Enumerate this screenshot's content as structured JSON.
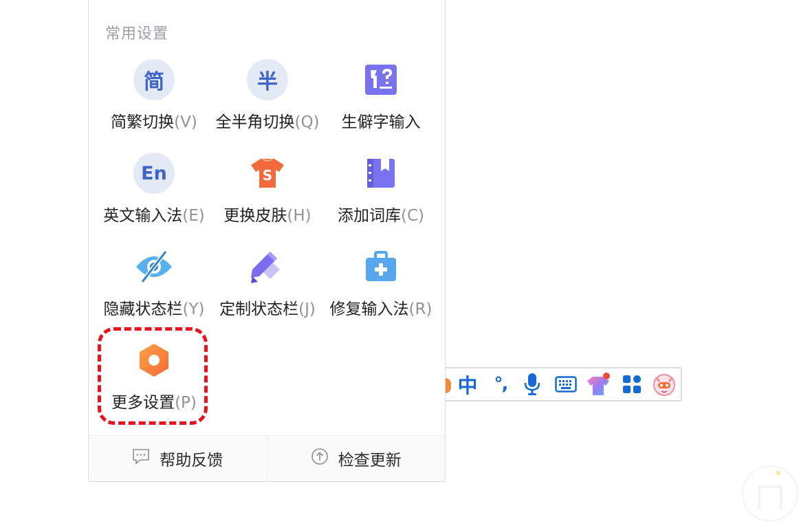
{
  "menu": {
    "section_title": "常用设置",
    "items": [
      {
        "label": "简繁切换",
        "hotkey": "(V)",
        "icon_char": "简",
        "icon": "traditional-simplified-icon"
      },
      {
        "label": "全半角切换",
        "hotkey": "(Q)",
        "icon_char": "半",
        "icon": "full-half-width-icon"
      },
      {
        "label": "生僻字输入",
        "hotkey": "",
        "icon": "rare-character-icon"
      },
      {
        "label": "英文输入法",
        "hotkey": "(E)",
        "icon_char": "En",
        "icon": "english-input-icon"
      },
      {
        "label": "更换皮肤",
        "hotkey": "(H)",
        "icon": "skin-shirt-icon"
      },
      {
        "label": "添加词库",
        "hotkey": "(C)",
        "icon": "dictionary-icon"
      },
      {
        "label": "隐藏状态栏",
        "hotkey": "(Y)",
        "icon": "hide-eye-icon"
      },
      {
        "label": "定制状态栏",
        "hotkey": "(J)",
        "icon": "customize-pencil-icon"
      },
      {
        "label": "修复输入法",
        "hotkey": "(R)",
        "icon": "repair-kit-icon"
      },
      {
        "label": "更多设置",
        "hotkey": "(P)",
        "icon": "more-settings-hex-icon"
      }
    ],
    "footer": {
      "help_label": "帮助反馈",
      "update_label": "检查更新"
    }
  },
  "status_bar": {
    "language_label": "中",
    "punct_label": "°,",
    "icons": [
      "chinese-mode-icon",
      "punctuation-icon",
      "microphone-icon",
      "keyboard-icon",
      "skin-shirt-icon",
      "toolbox-grid-icon",
      "mascot-avatar-icon"
    ]
  },
  "colors": {
    "highlight": "#e8131f",
    "accent_blue": "#1769d6",
    "accent_orange": "#f58a3a"
  }
}
